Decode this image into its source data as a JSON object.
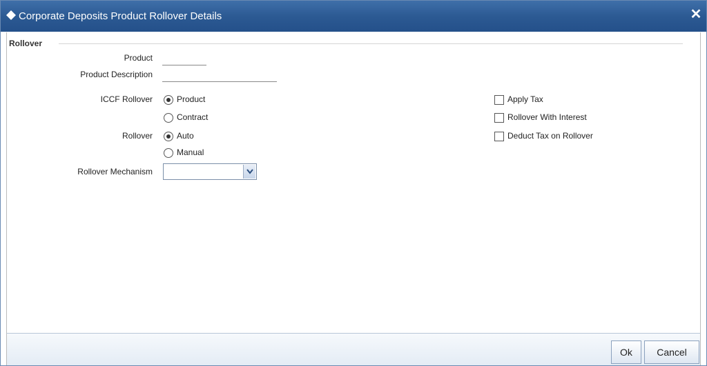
{
  "window": {
    "title": "Corporate Deposits Product Rollover Details"
  },
  "section": {
    "title": "Rollover"
  },
  "fields": {
    "product_label": "Product",
    "product_value": "",
    "product_description_label": "Product Description",
    "product_description_value": "",
    "iccf_rollover_label": "ICCF Rollover",
    "iccf_options": [
      {
        "label": "Product",
        "checked": true
      },
      {
        "label": "Contract",
        "checked": false
      }
    ],
    "rollover_label": "Rollover",
    "rollover_options": [
      {
        "label": "Auto",
        "checked": true
      },
      {
        "label": "Manual",
        "checked": false
      }
    ],
    "rollover_mechanism_label": "Rollover Mechanism",
    "rollover_mechanism_value": ""
  },
  "checkboxes": {
    "apply_tax": {
      "label": "Apply Tax",
      "checked": false
    },
    "rollover_with_interest": {
      "label": "Rollover With Interest",
      "checked": false
    },
    "deduct_tax_on_rollover": {
      "label": "Deduct Tax on Rollover",
      "checked": false
    }
  },
  "footer": {
    "ok_label": "Ok",
    "cancel_label": "Cancel"
  }
}
